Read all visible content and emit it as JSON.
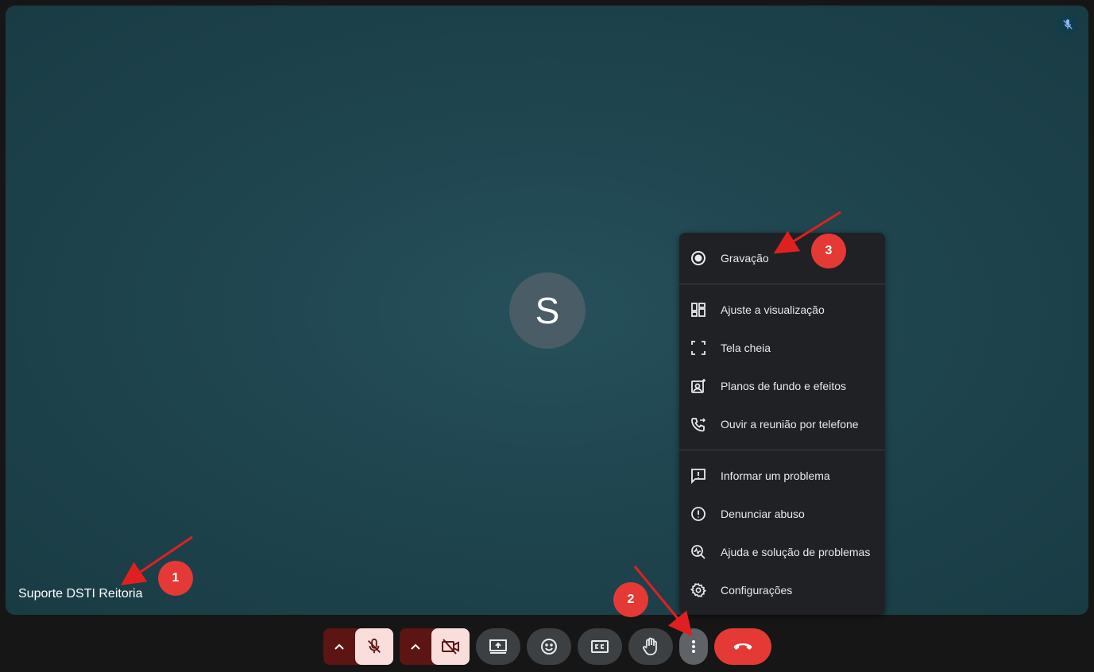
{
  "participant": {
    "initial": "S",
    "name": "Suporte DSTI Reitoria"
  },
  "menu": {
    "items": [
      {
        "label": "Gravação",
        "icon": "record-icon"
      },
      {
        "label": "Ajuste a visualização",
        "icon": "layout-icon"
      },
      {
        "label": "Tela cheia",
        "icon": "fullscreen-icon"
      },
      {
        "label": "Planos de fundo e efeitos",
        "icon": "background-effects-icon"
      },
      {
        "label": "Ouvir a reunião por telefone",
        "icon": "phone-forward-icon"
      },
      {
        "label": "Informar um problema",
        "icon": "feedback-icon"
      },
      {
        "label": "Denunciar abuso",
        "icon": "report-icon"
      },
      {
        "label": "Ajuda e solução de problemas",
        "icon": "help-troubleshoot-icon"
      },
      {
        "label": "Configurações",
        "icon": "settings-icon"
      }
    ]
  },
  "annotations": {
    "badge1": "1",
    "badge2": "2",
    "badge3": "3"
  },
  "colors": {
    "stage": "#1f454f",
    "menu_bg": "#202124",
    "danger": "#e53935",
    "muted_bg": "#5c1512",
    "muted_btn": "#f9dedc"
  }
}
